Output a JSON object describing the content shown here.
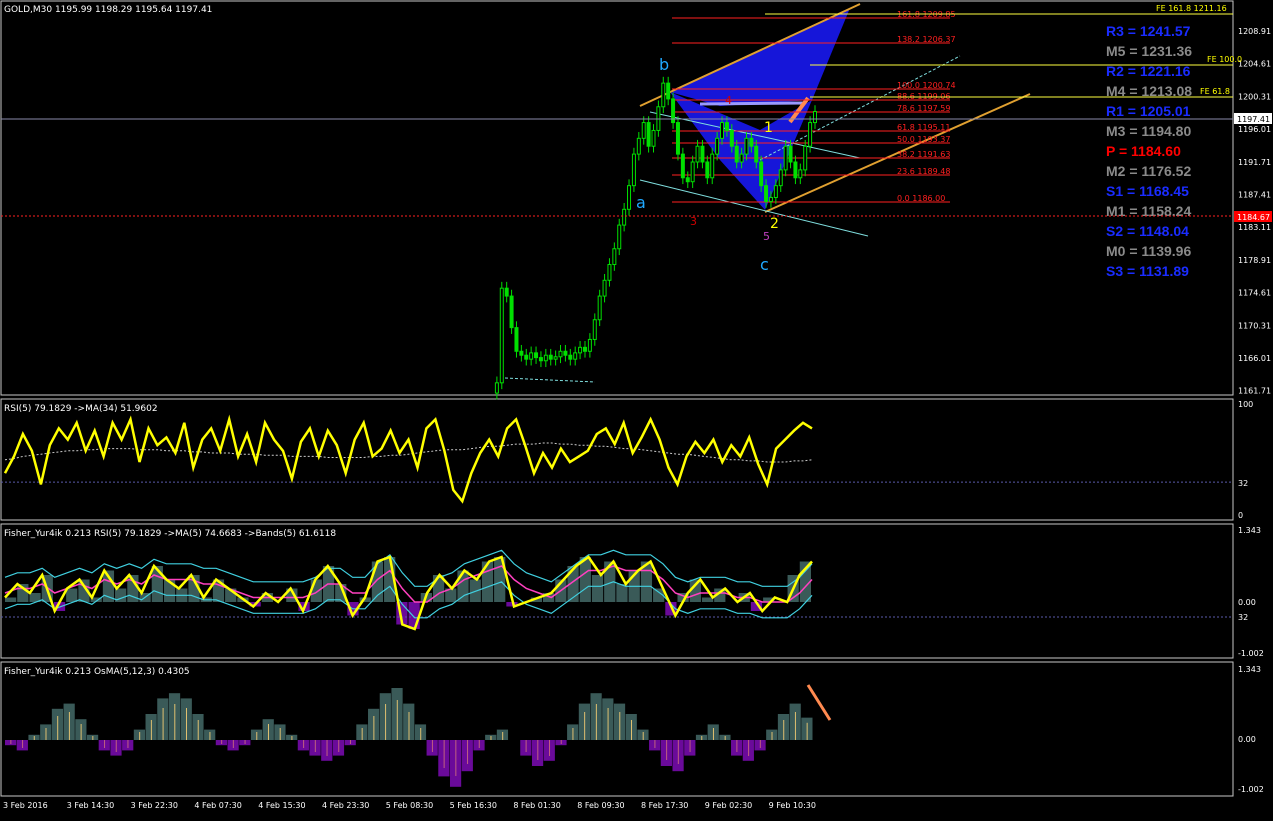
{
  "colors": {
    "background": "#000000",
    "candle": "#00e000",
    "grid_border": "#c8c8c8",
    "text": "#ffffff",
    "rsi_line": "#ffff00",
    "pivot_blue": "#1a2cff",
    "pivot_gray": "#8a8a8a",
    "pivot_red": "#ff0000",
    "fib_red": "#ff2020",
    "channel_orange": "#e0a030",
    "pattern_blue": "#1a1aff",
    "histogram_teal": "#3a5a58",
    "histogram_purple": "#6a0a9a"
  },
  "main": {
    "header": "GOLD,M30  1195.99 1198.29 1195.64 1197.41",
    "price_axis": [
      "1208.91",
      "1204.61",
      "1200.31",
      "1196.01",
      "1191.71",
      "1187.41",
      "1183.11",
      "1178.91",
      "1174.61",
      "1170.31",
      "1166.01",
      "1161.71"
    ],
    "current_price": "1197.41",
    "red_price": "1184.67",
    "fe_labels": [
      "FE 161.8 1211.16",
      "FE 100.0",
      "FE 61.8"
    ],
    "fib_labels": [
      "161.8  1209.85",
      "138.2  1206.37",
      "100.0  1200.74",
      "88.6  1199.06",
      "78.6  1197.59",
      "61.8  1195.11",
      "50.0  1193.37",
      "38.2  1191.63",
      "23.6  1189.48",
      "0.0  1186.00"
    ],
    "pivots": [
      {
        "label": "R3 = 1241.57",
        "color": "blue"
      },
      {
        "label": "M5 = 1231.36",
        "color": "gray"
      },
      {
        "label": "R2 = 1221.16",
        "color": "blue"
      },
      {
        "label": "M4 = 1213.08",
        "color": "gray"
      },
      {
        "label": "R1 = 1205.01",
        "color": "blue"
      },
      {
        "label": "M3 = 1194.80",
        "color": "gray"
      },
      {
        "label": "P   = 1184.60",
        "color": "red"
      },
      {
        "label": "M2 = 1176.52",
        "color": "gray"
      },
      {
        "label": "S1 = 1168.45",
        "color": "blue"
      },
      {
        "label": "M1 = 1158.24",
        "color": "gray"
      },
      {
        "label": "S2 = 1148.04",
        "color": "blue"
      },
      {
        "label": "M0 = 1139.96",
        "color": "gray"
      },
      {
        "label": "S3 = 1131.89",
        "color": "blue"
      }
    ],
    "wave_labels": {
      "a": "a",
      "b": "b",
      "c": "c",
      "one": "1",
      "two": "2",
      "three": "3",
      "four": "4",
      "five": "5"
    }
  },
  "rsi": {
    "header": "RSI(5) 79.1829  ->MA(34) 51.9602",
    "axis": [
      "100",
      "32",
      "0"
    ]
  },
  "fisher": {
    "header": "Fisher_Yur4ik 0.213  RSI(5) 79.1829  ->MA(5) 74.6683  ->Bands(5) 61.6118",
    "axis": [
      "1.343",
      "0.00",
      "32",
      "-1.002"
    ]
  },
  "osma": {
    "header": "Fisher_Yur4ik 0.213  OsMA(5,12,3) 0.4305",
    "axis": [
      "1.343",
      "0.00",
      "-1.002"
    ]
  },
  "time_axis": [
    "3 Feb 2016",
    "3 Feb 14:30",
    "3 Feb 22:30",
    "4 Feb 07:30",
    "4 Feb 15:30",
    "4 Feb 23:30",
    "5 Feb 08:30",
    "5 Feb 16:30",
    "8 Feb 01:30",
    "8 Feb 09:30",
    "8 Feb 17:30",
    "9 Feb 02:30",
    "9 Feb 10:30"
  ],
  "chart_data": [
    {
      "type": "candlestick",
      "title": "GOLD,M30",
      "ylim": [
        1161.71,
        1211.16
      ],
      "price_path": [
        1161.7,
        1163,
        1175,
        1174,
        1170,
        1167,
        1166.5,
        1166,
        1166.8,
        1166.2,
        1165.8,
        1166.5,
        1166,
        1166.3,
        1167,
        1166.5,
        1166,
        1166.8,
        1167.5,
        1167,
        1168.5,
        1171,
        1174,
        1176,
        1178,
        1180,
        1183,
        1185,
        1188,
        1192,
        1194,
        1196,
        1193,
        1195,
        1198,
        1201,
        1199,
        1196,
        1192,
        1189,
        1188.5,
        1191,
        1193,
        1191,
        1189,
        1192,
        1194,
        1196,
        1195,
        1193,
        1191,
        1192,
        1194,
        1193,
        1191,
        1188,
        1186,
        1186.5,
        1188,
        1190,
        1193,
        1191,
        1189,
        1190,
        1193,
        1196,
        1197.4
      ]
    },
    {
      "type": "line",
      "title": "RSI(5)",
      "ylim": [
        0,
        100
      ],
      "series": [
        {
          "name": "RSI(5)",
          "values": [
            40,
            55,
            75,
            60,
            30,
            65,
            80,
            70,
            85,
            60,
            78,
            55,
            85,
            70,
            88,
            50,
            80,
            65,
            72,
            58,
            85,
            45,
            70,
            80,
            60,
            88,
            55,
            75,
            50,
            85,
            70,
            60,
            35,
            68,
            80,
            55,
            78,
            65,
            40,
            70,
            85,
            55,
            62,
            78,
            58,
            70,
            45,
            80,
            88,
            60,
            25,
            15,
            40,
            58,
            70,
            55,
            80,
            88,
            65,
            40,
            58,
            45,
            62,
            50,
            55,
            60,
            75,
            80,
            66,
            85,
            58,
            72,
            88,
            70,
            45,
            30,
            55,
            68,
            58,
            70,
            50,
            65,
            55,
            72,
            48,
            30,
            62,
            70,
            78,
            85,
            80
          ]
        },
        {
          "name": "MA(34)",
          "values": [
            52,
            53,
            55,
            56,
            57,
            58,
            59,
            60,
            60,
            61,
            61,
            62,
            62,
            62,
            62,
            61,
            61,
            61,
            60,
            60,
            60,
            59,
            59,
            58,
            58,
            58,
            57,
            57,
            57,
            56,
            56,
            56,
            55,
            55,
            55,
            55,
            54,
            54,
            54,
            54,
            54,
            55,
            55,
            56,
            56,
            57,
            58,
            59,
            60,
            61,
            61,
            61,
            62,
            63,
            64,
            64,
            65,
            66,
            66,
            66,
            67,
            67,
            66,
            66,
            65,
            65,
            64,
            64,
            63,
            62,
            62,
            61,
            60,
            59,
            58,
            57,
            57,
            56,
            55,
            54,
            53,
            52,
            52,
            51,
            51,
            50,
            50,
            50,
            51,
            51,
            52
          ]
        }
      ]
    },
    {
      "type": "line",
      "title": "Fisher_Yur4ik RSI(5)",
      "ylim": [
        -1.002,
        1.343
      ],
      "series": [
        {
          "name": "RSI(5)",
          "values": [
            0.1,
            0.4,
            0.2,
            0.6,
            -0.2,
            0.3,
            0.5,
            0.1,
            0.7,
            0.3,
            0.6,
            0.2,
            0.8,
            0.5,
            0.3,
            0.6,
            0.1,
            0.5,
            0.3,
            0.1,
            -0.1,
            0.2,
            0.0,
            0.3,
            -0.2,
            0.5,
            0.8,
            0.4,
            -0.3,
            0.1,
            0.9,
            1.0,
            -0.5,
            -0.6,
            0.2,
            0.6,
            0.3,
            0.7,
            0.5,
            0.9,
            1.0,
            -0.1,
            0.0,
            0.1,
            0.2,
            0.5,
            0.8,
            1.0,
            0.6,
            0.9,
            0.4,
            0.7,
            0.9,
            0.3,
            -0.3,
            0.2,
            0.5,
            0.1,
            0.3,
            0.0,
            0.2,
            -0.2,
            0.1,
            0.0,
            0.6,
            0.9
          ]
        },
        {
          "name": "MA(5)",
          "values": [
            0.2,
            0.3,
            0.3,
            0.4,
            0.2,
            0.3,
            0.4,
            0.3,
            0.5,
            0.4,
            0.5,
            0.4,
            0.6,
            0.5,
            0.5,
            0.5,
            0.4,
            0.4,
            0.3,
            0.2,
            0.1,
            0.1,
            0.1,
            0.1,
            0.1,
            0.2,
            0.4,
            0.4,
            0.2,
            0.2,
            0.5,
            0.7,
            0.3,
            0.0,
            0.0,
            0.2,
            0.3,
            0.5,
            0.6,
            0.7,
            0.8,
            0.5,
            0.3,
            0.2,
            0.1,
            0.3,
            0.5,
            0.7,
            0.7,
            0.8,
            0.7,
            0.7,
            0.7,
            0.5,
            0.2,
            0.1,
            0.2,
            0.2,
            0.2,
            0.1,
            0.1,
            0.0,
            0.0,
            0.0,
            0.2,
            0.5
          ]
        }
      ]
    },
    {
      "type": "bar",
      "title": "OsMA(5,12,3)",
      "ylim": [
        -1.002,
        1.343
      ],
      "values": [
        -0.1,
        -0.2,
        0.1,
        0.3,
        0.6,
        0.7,
        0.4,
        0.1,
        -0.2,
        -0.3,
        -0.2,
        0.2,
        0.5,
        0.8,
        0.9,
        0.8,
        0.5,
        0.2,
        -0.1,
        -0.2,
        -0.1,
        0.2,
        0.4,
        0.3,
        0.1,
        -0.2,
        -0.3,
        -0.4,
        -0.3,
        -0.1,
        0.3,
        0.6,
        0.9,
        1.0,
        0.7,
        0.3,
        -0.3,
        -0.7,
        -0.9,
        -0.6,
        -0.2,
        0.1,
        0.2,
        0.0,
        -0.3,
        -0.5,
        -0.4,
        -0.1,
        0.3,
        0.7,
        0.9,
        0.8,
        0.7,
        0.5,
        0.2,
        -0.2,
        -0.5,
        -0.6,
        -0.3,
        0.1,
        0.3,
        0.1,
        -0.3,
        -0.4,
        -0.2,
        0.2,
        0.5,
        0.7,
        0.43
      ]
    }
  ]
}
